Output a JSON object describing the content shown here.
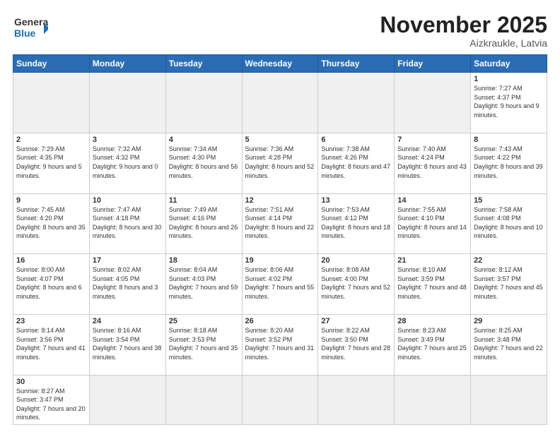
{
  "header": {
    "logo_general": "General",
    "logo_blue": "Blue",
    "month_title": "November 2025",
    "subtitle": "Aizkraukle, Latvia"
  },
  "weekdays": [
    "Sunday",
    "Monday",
    "Tuesday",
    "Wednesday",
    "Thursday",
    "Friday",
    "Saturday"
  ],
  "days": {
    "1": {
      "sunrise": "7:27 AM",
      "sunset": "4:37 PM",
      "daylight": "9 hours and 9 minutes."
    },
    "2": {
      "sunrise": "7:29 AM",
      "sunset": "4:35 PM",
      "daylight": "9 hours and 5 minutes."
    },
    "3": {
      "sunrise": "7:32 AM",
      "sunset": "4:32 PM",
      "daylight": "9 hours and 0 minutes."
    },
    "4": {
      "sunrise": "7:34 AM",
      "sunset": "4:30 PM",
      "daylight": "8 hours and 56 minutes."
    },
    "5": {
      "sunrise": "7:36 AM",
      "sunset": "4:28 PM",
      "daylight": "8 hours and 52 minutes."
    },
    "6": {
      "sunrise": "7:38 AM",
      "sunset": "4:26 PM",
      "daylight": "8 hours and 47 minutes."
    },
    "7": {
      "sunrise": "7:40 AM",
      "sunset": "4:24 PM",
      "daylight": "8 hours and 43 minutes."
    },
    "8": {
      "sunrise": "7:43 AM",
      "sunset": "4:22 PM",
      "daylight": "8 hours and 39 minutes."
    },
    "9": {
      "sunrise": "7:45 AM",
      "sunset": "4:20 PM",
      "daylight": "8 hours and 35 minutes."
    },
    "10": {
      "sunrise": "7:47 AM",
      "sunset": "4:18 PM",
      "daylight": "8 hours and 30 minutes."
    },
    "11": {
      "sunrise": "7:49 AM",
      "sunset": "4:16 PM",
      "daylight": "8 hours and 26 minutes."
    },
    "12": {
      "sunrise": "7:51 AM",
      "sunset": "4:14 PM",
      "daylight": "8 hours and 22 minutes."
    },
    "13": {
      "sunrise": "7:53 AM",
      "sunset": "4:12 PM",
      "daylight": "8 hours and 18 minutes."
    },
    "14": {
      "sunrise": "7:55 AM",
      "sunset": "4:10 PM",
      "daylight": "8 hours and 14 minutes."
    },
    "15": {
      "sunrise": "7:58 AM",
      "sunset": "4:08 PM",
      "daylight": "8 hours and 10 minutes."
    },
    "16": {
      "sunrise": "8:00 AM",
      "sunset": "4:07 PM",
      "daylight": "8 hours and 6 minutes."
    },
    "17": {
      "sunrise": "8:02 AM",
      "sunset": "4:05 PM",
      "daylight": "8 hours and 3 minutes."
    },
    "18": {
      "sunrise": "8:04 AM",
      "sunset": "4:03 PM",
      "daylight": "7 hours and 59 minutes."
    },
    "19": {
      "sunrise": "8:06 AM",
      "sunset": "4:02 PM",
      "daylight": "7 hours and 55 minutes."
    },
    "20": {
      "sunrise": "8:08 AM",
      "sunset": "4:00 PM",
      "daylight": "7 hours and 52 minutes."
    },
    "21": {
      "sunrise": "8:10 AM",
      "sunset": "3:59 PM",
      "daylight": "7 hours and 48 minutes."
    },
    "22": {
      "sunrise": "8:12 AM",
      "sunset": "3:57 PM",
      "daylight": "7 hours and 45 minutes."
    },
    "23": {
      "sunrise": "8:14 AM",
      "sunset": "3:56 PM",
      "daylight": "7 hours and 41 minutes."
    },
    "24": {
      "sunrise": "8:16 AM",
      "sunset": "3:54 PM",
      "daylight": "7 hours and 38 minutes."
    },
    "25": {
      "sunrise": "8:18 AM",
      "sunset": "3:53 PM",
      "daylight": "7 hours and 35 minutes."
    },
    "26": {
      "sunrise": "8:20 AM",
      "sunset": "3:52 PM",
      "daylight": "7 hours and 31 minutes."
    },
    "27": {
      "sunrise": "8:22 AM",
      "sunset": "3:50 PM",
      "daylight": "7 hours and 28 minutes."
    },
    "28": {
      "sunrise": "8:23 AM",
      "sunset": "3:49 PM",
      "daylight": "7 hours and 25 minutes."
    },
    "29": {
      "sunrise": "8:25 AM",
      "sunset": "3:48 PM",
      "daylight": "7 hours and 22 minutes."
    },
    "30": {
      "sunrise": "8:27 AM",
      "sunset": "3:47 PM",
      "daylight": "7 hours and 20 minutes."
    }
  }
}
